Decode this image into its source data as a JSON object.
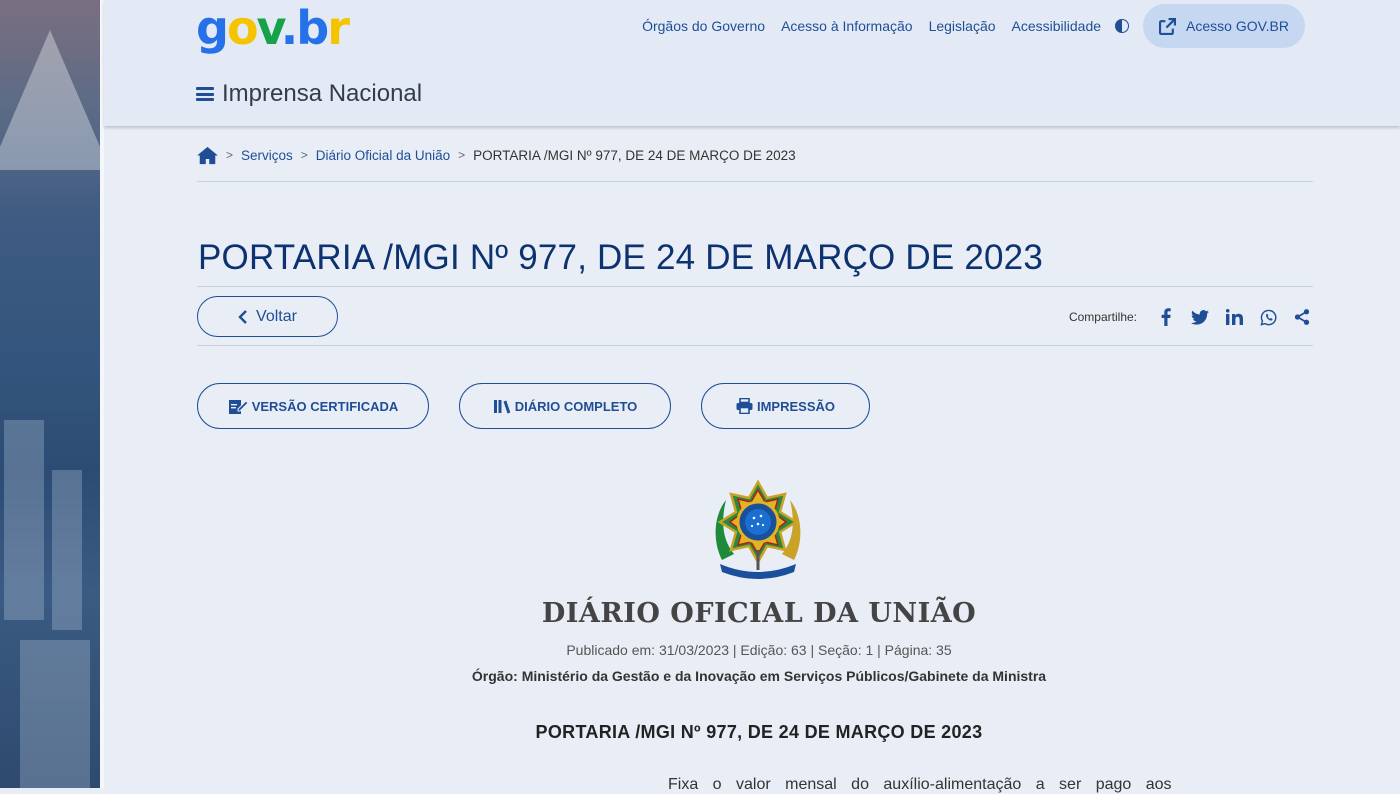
{
  "header": {
    "logo": {
      "g": "g",
      "o": "o",
      "v": "v",
      "dot": ".",
      "b": "b",
      "r": "r"
    },
    "nav": [
      "Órgãos do Governo",
      "Acesso à Informação",
      "Legislação",
      "Acessibilidade"
    ],
    "login_label": "Acesso GOV.BR",
    "site_name": "Imprensa Nacional"
  },
  "breadcrumb": {
    "items": [
      "Serviços",
      "Diário Oficial da União"
    ],
    "current": "PORTARIA /MGI Nº 977, DE 24 DE MARÇO DE 2023",
    "separator": ">"
  },
  "page": {
    "title": "PORTARIA /MGI Nº 977, DE 24 DE MARÇO DE 2023",
    "back_label": "Voltar",
    "share_label": "Compartilhe:",
    "share_icons": [
      "facebook-icon",
      "twitter-icon",
      "linkedin-icon",
      "whatsapp-icon",
      "share-icon"
    ],
    "actions": [
      "VERSÃO CERTIFICADA",
      "DIÁRIO COMPLETO",
      "IMPRESSÃO"
    ]
  },
  "document": {
    "masthead": "DIÁRIO OFICIAL DA UNIÃO",
    "published": "Publicado em: 31/03/2023 | Edição: 63 | Seção: 1 | Página: 35",
    "orgao_label": "Órgão:",
    "orgao_value": "Ministério da Gestão e da Inovação em Serviços Públicos/Gabinete da Ministra",
    "heading": "PORTARIA /MGI Nº 977, DE 24 DE MARÇO DE 2023",
    "first_line": "Fixa o valor mensal do auxílio-alimentação a ser pago aos"
  },
  "colors": {
    "primary": "#1f4e96",
    "title": "#0c326f",
    "background": "#e9eef6",
    "login_bg": "#c6d8f1"
  }
}
